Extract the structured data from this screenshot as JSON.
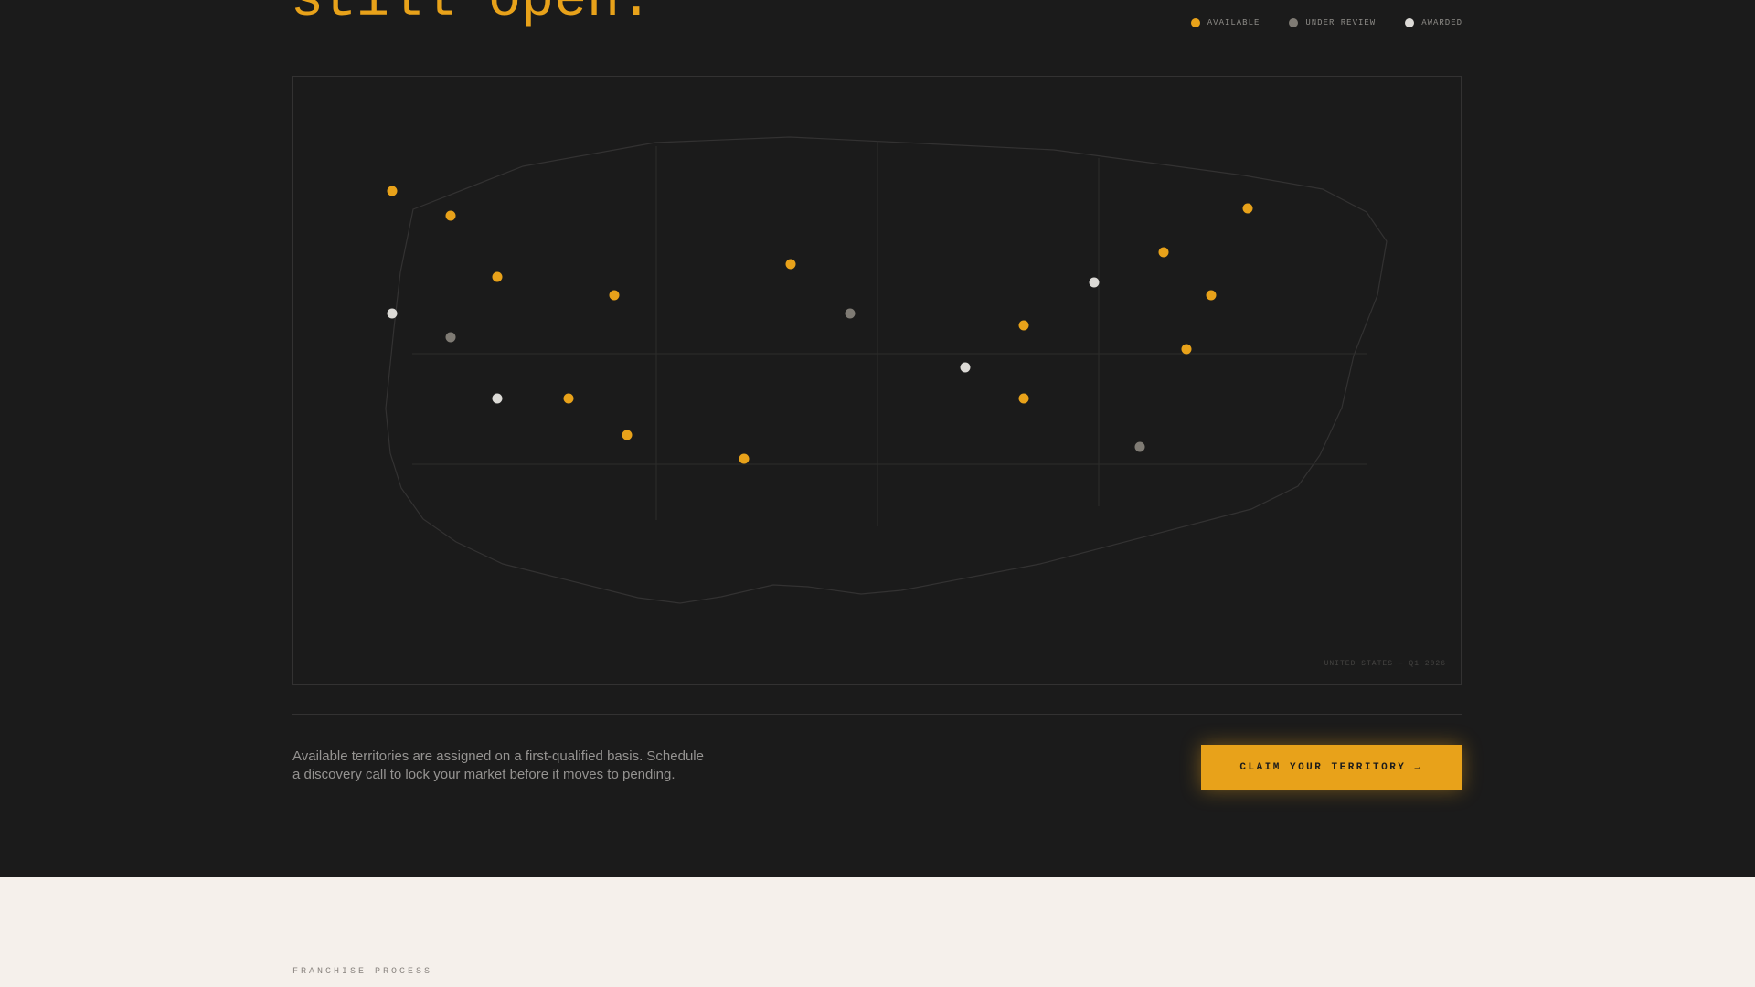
{
  "hero": {
    "headline": "still open."
  },
  "legend": {
    "items": [
      {
        "label": "AVAILABLE",
        "color": "#e8a21a"
      },
      {
        "label": "UNDER REVIEW",
        "color": "#7f7b74"
      },
      {
        "label": "AWARDED",
        "color": "#dcdad6"
      }
    ]
  },
  "map": {
    "caption": "UNITED STATES — Q1 2026",
    "territories": [
      {
        "status": "available"
      },
      {
        "status": "available"
      },
      {
        "status": "available"
      },
      {
        "status": "available"
      },
      {
        "status": "available"
      },
      {
        "status": "available"
      },
      {
        "status": "available"
      },
      {
        "status": "available"
      },
      {
        "status": "available"
      },
      {
        "status": "available"
      },
      {
        "status": "available"
      },
      {
        "status": "available"
      },
      {
        "status": "available"
      },
      {
        "status": "available"
      },
      {
        "status": "under_review"
      },
      {
        "status": "under_review"
      },
      {
        "status": "under_review"
      },
      {
        "status": "awarded"
      },
      {
        "status": "awarded"
      },
      {
        "status": "awarded"
      },
      {
        "status": "awarded"
      }
    ]
  },
  "cta": {
    "text": "Available territories are assigned on a first-qualified basis. Schedule a discovery call to lock your market before it moves to pending.",
    "button_label": "CLAIM YOUR TERRITORY →"
  },
  "process": {
    "eyebrow": "FRANCHISE PROCESS"
  }
}
